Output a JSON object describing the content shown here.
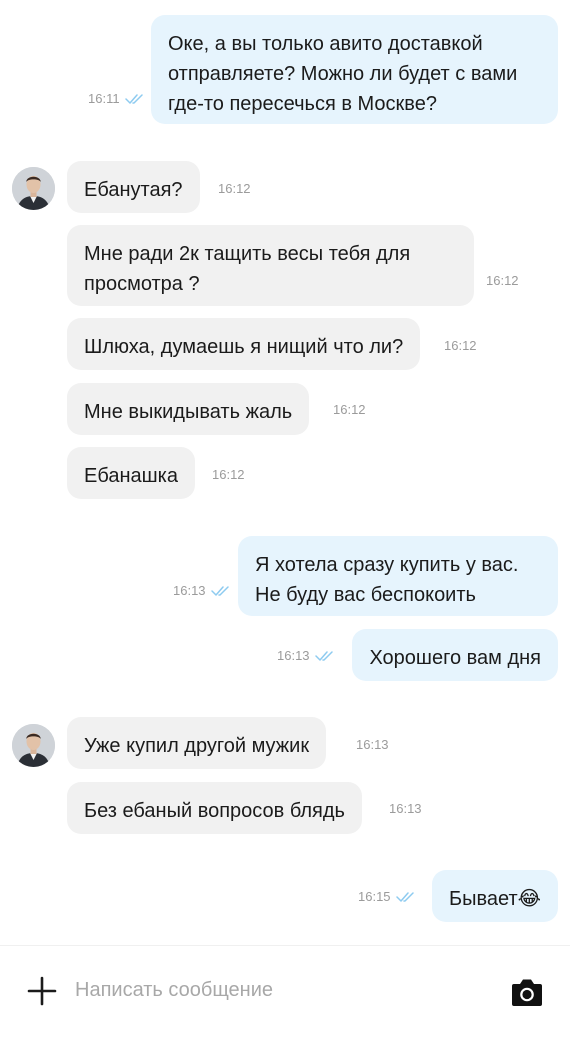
{
  "messages": [
    {
      "direction": "out",
      "text": "Оке, а вы только авито доставкой\nотправляете? Можно ли будет с вами\nгде-то пересечься в Москве?",
      "time": "16:11",
      "read": true
    },
    {
      "direction": "in",
      "text": "Ебанутая?",
      "time": "16:12",
      "avatar": true
    },
    {
      "direction": "in",
      "text": "Мне ради 2к тащить весы тебя для\nпросмотра ?",
      "time": "16:12"
    },
    {
      "direction": "in",
      "text": "Шлюха, думаешь я нищий что ли?",
      "time": "16:12"
    },
    {
      "direction": "in",
      "text": "Мне выкидывать жаль",
      "time": "16:12"
    },
    {
      "direction": "in",
      "text": "Ебанашка",
      "time": "16:12"
    },
    {
      "direction": "out",
      "text": "Я хотела сразу купить у вас.\nНе буду вас беспокоить",
      "time": "16:13",
      "read": true
    },
    {
      "direction": "out",
      "text": "Хорошего вам дня",
      "time": "16:13",
      "read": true
    },
    {
      "direction": "in",
      "text": "Уже купил другой мужик",
      "time": "16:13",
      "avatar": true
    },
    {
      "direction": "in",
      "text": "Без ебаный вопросов блядь",
      "time": "16:13"
    },
    {
      "direction": "out",
      "text": "Бывает😂",
      "time": "16:15",
      "read": true
    }
  ],
  "composer": {
    "placeholder": "Написать сообщение",
    "attach_icon": "plus-icon",
    "camera_icon": "camera-icon"
  },
  "colors": {
    "incoming_bubble": "#f1f1f1",
    "outgoing_bubble": "#e6f4fd",
    "read_check": "#8ecbf0",
    "timestamp": "#9b9b9b"
  }
}
